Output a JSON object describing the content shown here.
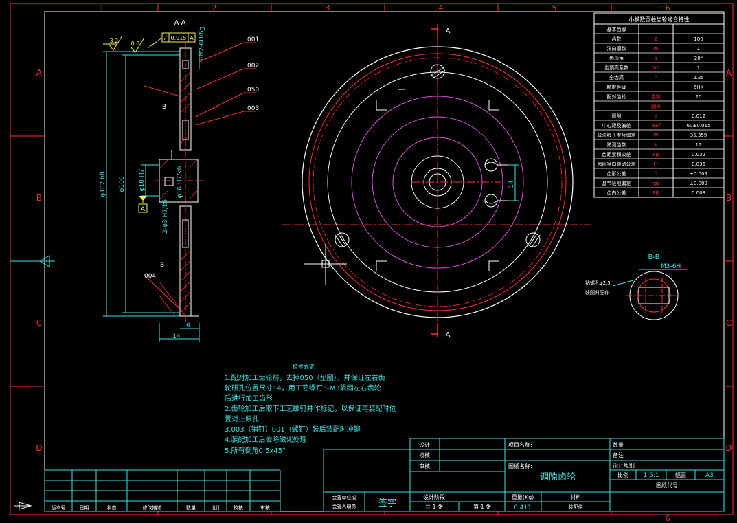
{
  "border": {
    "columns": [
      "1",
      "2",
      "3",
      "4",
      "5",
      "6"
    ],
    "rows": [
      "A",
      "B",
      "C",
      "D"
    ]
  },
  "section_view": {
    "label": "A-A",
    "roughness": "3.2",
    "flatness": "0.8",
    "tolerance_frame": "0.015",
    "tolerance_datum": "A",
    "tap_callout": "3-M2-6H/6g",
    "part_tags": [
      "001",
      "002",
      "050",
      "003",
      "004"
    ],
    "side_mark": "B",
    "dim_outer": "φ102 h8",
    "dim_inner": "φ100",
    "dim_bore_small": "φ10 H7",
    "dim_bore_large": "φ16 H7/k6",
    "dim_pins": "2-φ3 H7/k6",
    "dim_width": "14",
    "dim_step": "6",
    "datum": "A"
  },
  "front_view": {
    "section_mark": "A",
    "dim_slot": "14"
  },
  "section_bb": {
    "label": "B-B",
    "thread": "M3-6H",
    "note_line1": "钻螺孔φ2.5",
    "note_line2": "装配时配作"
  },
  "gear_params": {
    "title": "小模数圆柱齿轮啮合特性",
    "rows": [
      {
        "label": "基本齿廓",
        "symbol": "",
        "value": ""
      },
      {
        "label": "齿数",
        "symbol": "Z",
        "value": "100"
      },
      {
        "label": "法向模数",
        "symbol": "m",
        "value": "1"
      },
      {
        "label": "齿形角",
        "symbol": "α",
        "value": "20°"
      },
      {
        "label": "齿顶高系数",
        "symbol": "h*",
        "value": "1"
      },
      {
        "label": "全齿高",
        "symbol": "h",
        "value": "2.25"
      },
      {
        "label": "精度等级",
        "symbol": "",
        "value": "6HK"
      },
      {
        "label": "配对齿轮",
        "symbol": "齿数",
        "value": "20"
      },
      {
        "label": "",
        "symbol": "图号",
        "value": ""
      },
      {
        "label": "侧隙",
        "symbol": "j",
        "value": "0.012"
      },
      {
        "label": "中心距及偏差",
        "symbol": "a±f",
        "value": "60±0.015"
      },
      {
        "label": "公法线长度及偏差",
        "symbol": "W",
        "value": "35.359"
      },
      {
        "label": "跨测齿数",
        "symbol": "k",
        "value": "12"
      },
      {
        "label": "齿距累积公差",
        "symbol": "Fp",
        "value": "0.032"
      },
      {
        "label": "齿圈径向跳动公差",
        "symbol": "Fr",
        "value": "0.036"
      },
      {
        "label": "齿形公差",
        "symbol": "ff",
        "value": "±0.009"
      },
      {
        "label": "基节极限偏差",
        "symbol": "fpb",
        "value": "±0.009"
      },
      {
        "label": "齿向公差",
        "symbol": "Fβ",
        "value": "0.008"
      }
    ]
  },
  "tech_requirements": {
    "title": "技术要求",
    "lines": [
      "1.配对加工齿轮前，去掉050（垫圈），并保证左右齿",
      "轮研孔位置尺寸14，用工艺螺钉3-M3紧固左右齿轮",
      "后进行加工齿形",
      "2.齿轮加工后取下工艺螺钉并作标记，以保证再装配时位",
      "置对正原孔",
      "3.003（销钉）001（螺钉）装后装配时冲铆",
      "4.装配加工后去除磁化处理",
      "5.所有倒角0.5x45°"
    ]
  },
  "revision_table": {
    "headers": [
      "版本号",
      "日期",
      "状态",
      "修改描述",
      "数量",
      "设计",
      "校核",
      "审核"
    ]
  },
  "title_block": {
    "design": "设计",
    "check": "校核",
    "review": "审核",
    "project_label": "项目名称:",
    "drawing_name_label": "图纸名称:",
    "part_name": "调隙齿轮",
    "quantity": "数量",
    "remark": "备注",
    "design_group": "设计组别",
    "scale_label": "比例",
    "scale_value": "1.5:1",
    "size_label": "幅面",
    "size_value": "A3",
    "drawing_code": "图纸代号",
    "company_line1": "会签单位或",
    "company_line2": "会签人职务",
    "signature": "签字",
    "stage": "设计阶段",
    "sheets_total": "共 1 张",
    "sheet_no": "第 1 张",
    "weight_label": "重量(Kg)",
    "weight_value": "0.411",
    "material_label": "材料",
    "material_value": "装配件"
  },
  "colors": {
    "background": "#000000",
    "frame": "#ffffff",
    "cyan": "#3fe0e0",
    "red": "#ff3030",
    "magenta": "#e050e0",
    "yellow": "#f0f060"
  }
}
